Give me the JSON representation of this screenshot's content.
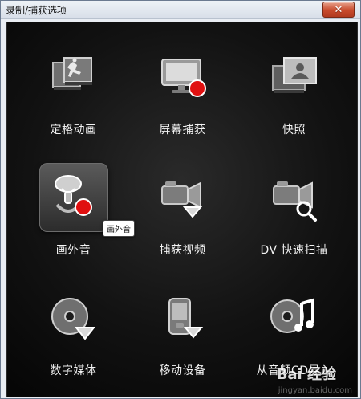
{
  "window": {
    "title": "录制/捕获选项"
  },
  "close_button": {
    "label": "✕"
  },
  "tiles": [
    {
      "label": "定格动画",
      "icon": "stop-motion-icon"
    },
    {
      "label": "屏幕捕获",
      "icon": "screen-capture-icon"
    },
    {
      "label": "快照",
      "icon": "snapshot-icon"
    },
    {
      "label": "画外音",
      "icon": "voiceover-microphone-icon",
      "selected": true,
      "tooltip": "画外音"
    },
    {
      "label": "捕获视频",
      "icon": "capture-video-icon"
    },
    {
      "label": "DV 快速扫描",
      "icon": "dv-quick-scan-icon"
    },
    {
      "label": "数字媒体",
      "icon": "digital-media-icon"
    },
    {
      "label": "移动设备",
      "icon": "mobile-device-icon"
    },
    {
      "label": "从音频CD导入",
      "icon": "import-audio-cd-icon"
    }
  ],
  "watermark": {
    "text": "jingyan.baidu.com",
    "brand": "Bai 经验"
  },
  "colors": {
    "panel_dark": "#121212",
    "accent_red": "#e01010",
    "label_text": "#f2f2f2",
    "selected_tile": "#4a4a4a"
  }
}
